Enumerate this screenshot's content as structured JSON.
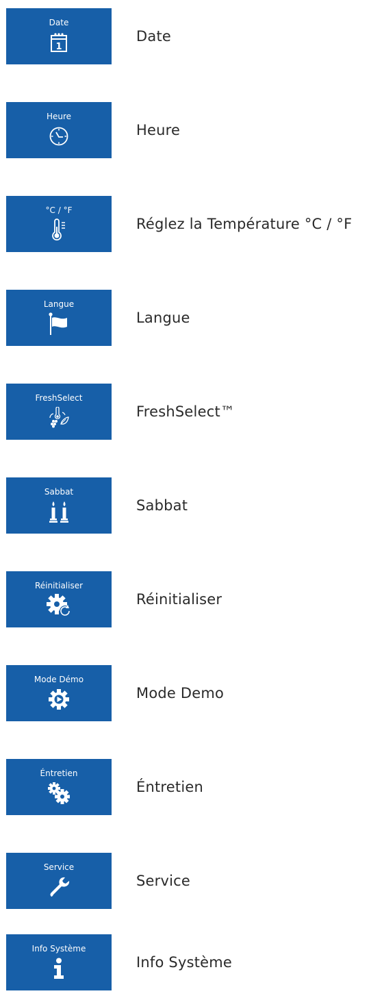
{
  "menu": {
    "items": [
      {
        "tile_label": "Date",
        "label": "Date",
        "icon": "calendar-icon"
      },
      {
        "tile_label": "Heure",
        "label": "Heure",
        "icon": "clock-icon"
      },
      {
        "tile_label": "°C / °F",
        "label": "Réglez la Température °C / °F",
        "icon": "thermometer-icon"
      },
      {
        "tile_label": "Langue",
        "label": "Langue",
        "icon": "flag-icon"
      },
      {
        "tile_label": "FreshSelect",
        "label": "FreshSelect™",
        "icon": "fresh-select-icon"
      },
      {
        "tile_label": "Sabbat",
        "label": "Sabbat",
        "icon": "candles-icon"
      },
      {
        "tile_label": "Réinitialiser",
        "label": "Réinitialiser",
        "icon": "reset-gear-icon"
      },
      {
        "tile_label": "Mode Démo",
        "label": "Mode Demo",
        "icon": "demo-gear-icon"
      },
      {
        "tile_label": "Éntretien",
        "label": "Éntretien",
        "icon": "gears-icon"
      },
      {
        "tile_label": "Service",
        "label": "Service",
        "icon": "wrench-icon"
      },
      {
        "tile_label": "Info Système",
        "label": "Info Système",
        "icon": "info-icon"
      }
    ],
    "calendar_day": "1"
  },
  "colors": {
    "tile_background": "#175fa8",
    "tile_foreground": "#ffffff",
    "label_text": "#2a2a2a"
  }
}
